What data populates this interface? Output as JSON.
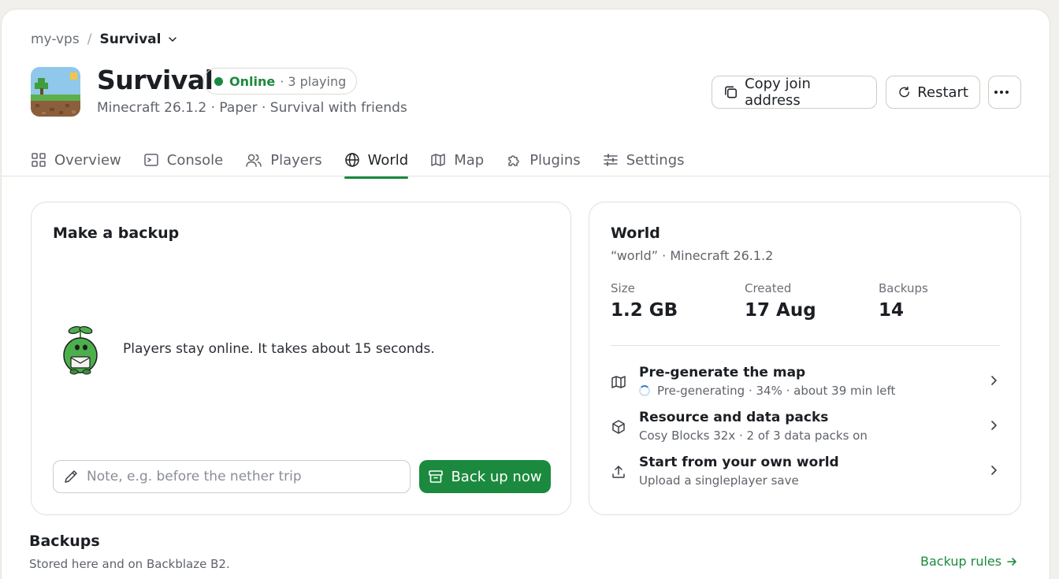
{
  "breadcrumb": {
    "parent": "my-vps",
    "separator": "/",
    "current": "Survival"
  },
  "server": {
    "name": "Survival",
    "status": "Online",
    "players": "· 3 playing",
    "subtitle": "Minecraft 26.1.2 · Paper · Survival with friends",
    "icon": "minecraft-grass-block-icon"
  },
  "actions": {
    "copy_join": "Copy join address",
    "restart": "Restart",
    "more": "more-icon"
  },
  "tabs": [
    {
      "label": "Overview",
      "icon": "grid-icon"
    },
    {
      "label": "Console",
      "icon": "terminal-icon"
    },
    {
      "label": "Players",
      "icon": "users-icon"
    },
    {
      "label": "World",
      "icon": "globe-icon",
      "active": true
    },
    {
      "label": "Map",
      "icon": "map-icon"
    },
    {
      "label": "Plugins",
      "icon": "puzzle-icon"
    },
    {
      "label": "Settings",
      "icon": "sliders-icon"
    }
  ],
  "backup_card": {
    "title": "Make a backup",
    "message": "Players stay online. It takes about 15 seconds.",
    "note_placeholder": "Note, e.g. before the nether trip",
    "note_value": "",
    "button": "Back up now"
  },
  "world_card": {
    "title": "World",
    "subtitle": "“world” · Minecraft 26.1.2",
    "stats": [
      {
        "label": "Size",
        "value": "1.2 GB"
      },
      {
        "label": "Created",
        "value": "17 Aug"
      },
      {
        "label": "Backups",
        "value": "14"
      }
    ],
    "rows": [
      {
        "title": "Pre-generate the map",
        "subtitle": "Pre-generating · 34% · about 39 min left",
        "progress_percent": 34,
        "icon": "map-icon"
      },
      {
        "title": "Resource and data packs",
        "subtitle": "Cosy Blocks 32x · 2 of 3 data packs on",
        "icon": "package-icon"
      },
      {
        "title": "Start from your own world",
        "subtitle": "Upload a singleplayer save",
        "icon": "upload-icon"
      }
    ]
  },
  "backups_section": {
    "title": "Backups",
    "subtitle": "Stored here and on Backblaze B2.",
    "rules_link": "Backup rules"
  },
  "colors": {
    "accent": "#1b8a3e",
    "page_bg": "#f1f0ec",
    "card_bg": "#ffffff",
    "text": "#1f2328",
    "muted": "#5f636a"
  }
}
